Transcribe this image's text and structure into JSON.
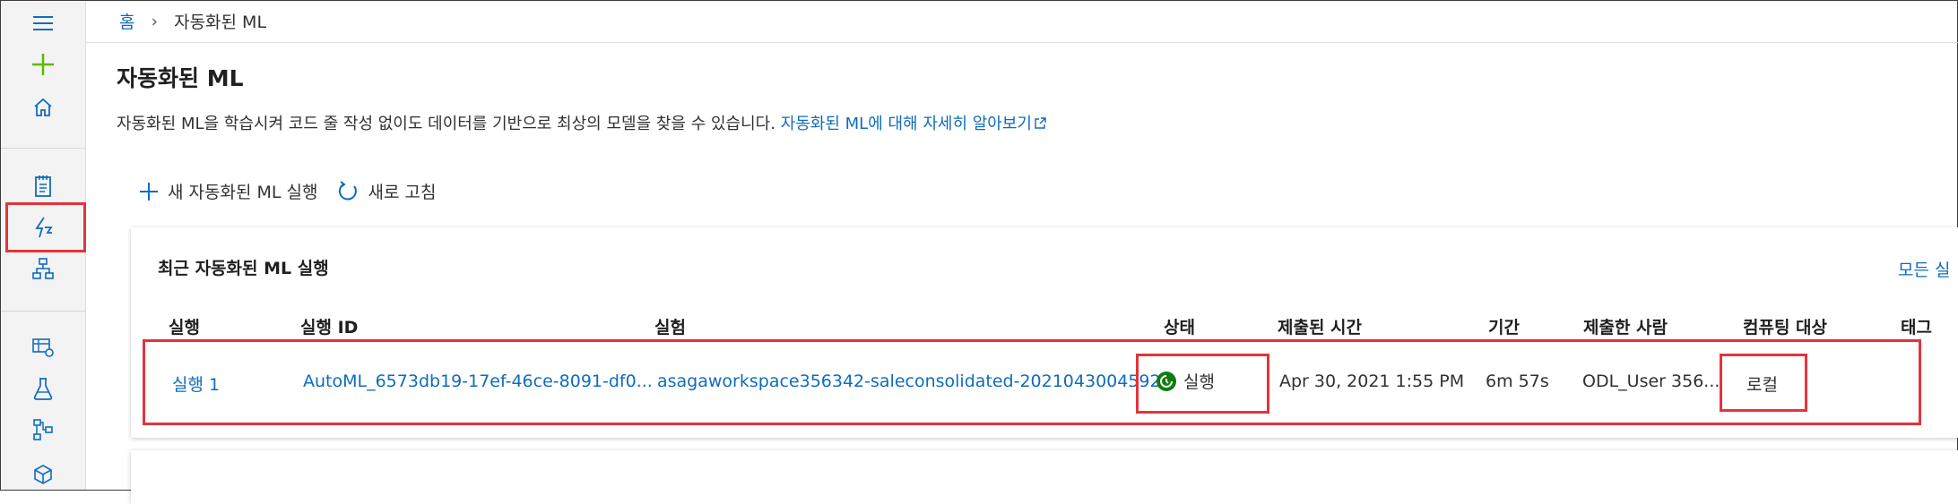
{
  "breadcrumb": {
    "home": "홈",
    "separator": "›",
    "current": "자동화된 ML"
  },
  "page": {
    "title": "자동화된 ML",
    "description": "자동화된 ML을 학습시켜 코드 줄 작성 없이도 데이터를 기반으로 최상의 모델을 찾을 수 있습니다.",
    "learn_more": "자동화된 ML에 대해 자세히 알아보기"
  },
  "toolbar": {
    "new_run": "새 자동화된 ML 실행",
    "refresh": "새로 고침"
  },
  "card": {
    "title": "최근 자동화된 ML 실행",
    "view_all": "모든 실",
    "columns": [
      "실행",
      "실행 ID",
      "실험",
      "상태",
      "제출된 시간",
      "기간",
      "제출한 사람",
      "컴퓨팅 대상",
      "태그"
    ],
    "rows": [
      {
        "run": "실행 1",
        "run_id": "AutoML_6573db19-17ef-46ce-8091-df0...",
        "experiment": "asagaworkspace356342-saleconsolidated-20210430045928",
        "status": "실행",
        "submitted": "Apr 30, 2021 1:55 PM",
        "duration": "6m 57s",
        "submitted_by": "ODL_User 356...",
        "compute": "로컬",
        "tags": ""
      }
    ]
  },
  "colors": {
    "accent": "#0f6cbd",
    "highlight": "#e3333d",
    "status_running": "#107c10",
    "new_icon": "#5fb800"
  },
  "icons": [
    "menu-icon",
    "plus-icon",
    "home-icon",
    "notebook-icon",
    "automl-icon",
    "designer-icon",
    "datasets-icon",
    "experiments-icon",
    "pipelines-icon",
    "models-icon",
    "external-link-icon",
    "refresh-icon",
    "running-status-icon"
  ]
}
